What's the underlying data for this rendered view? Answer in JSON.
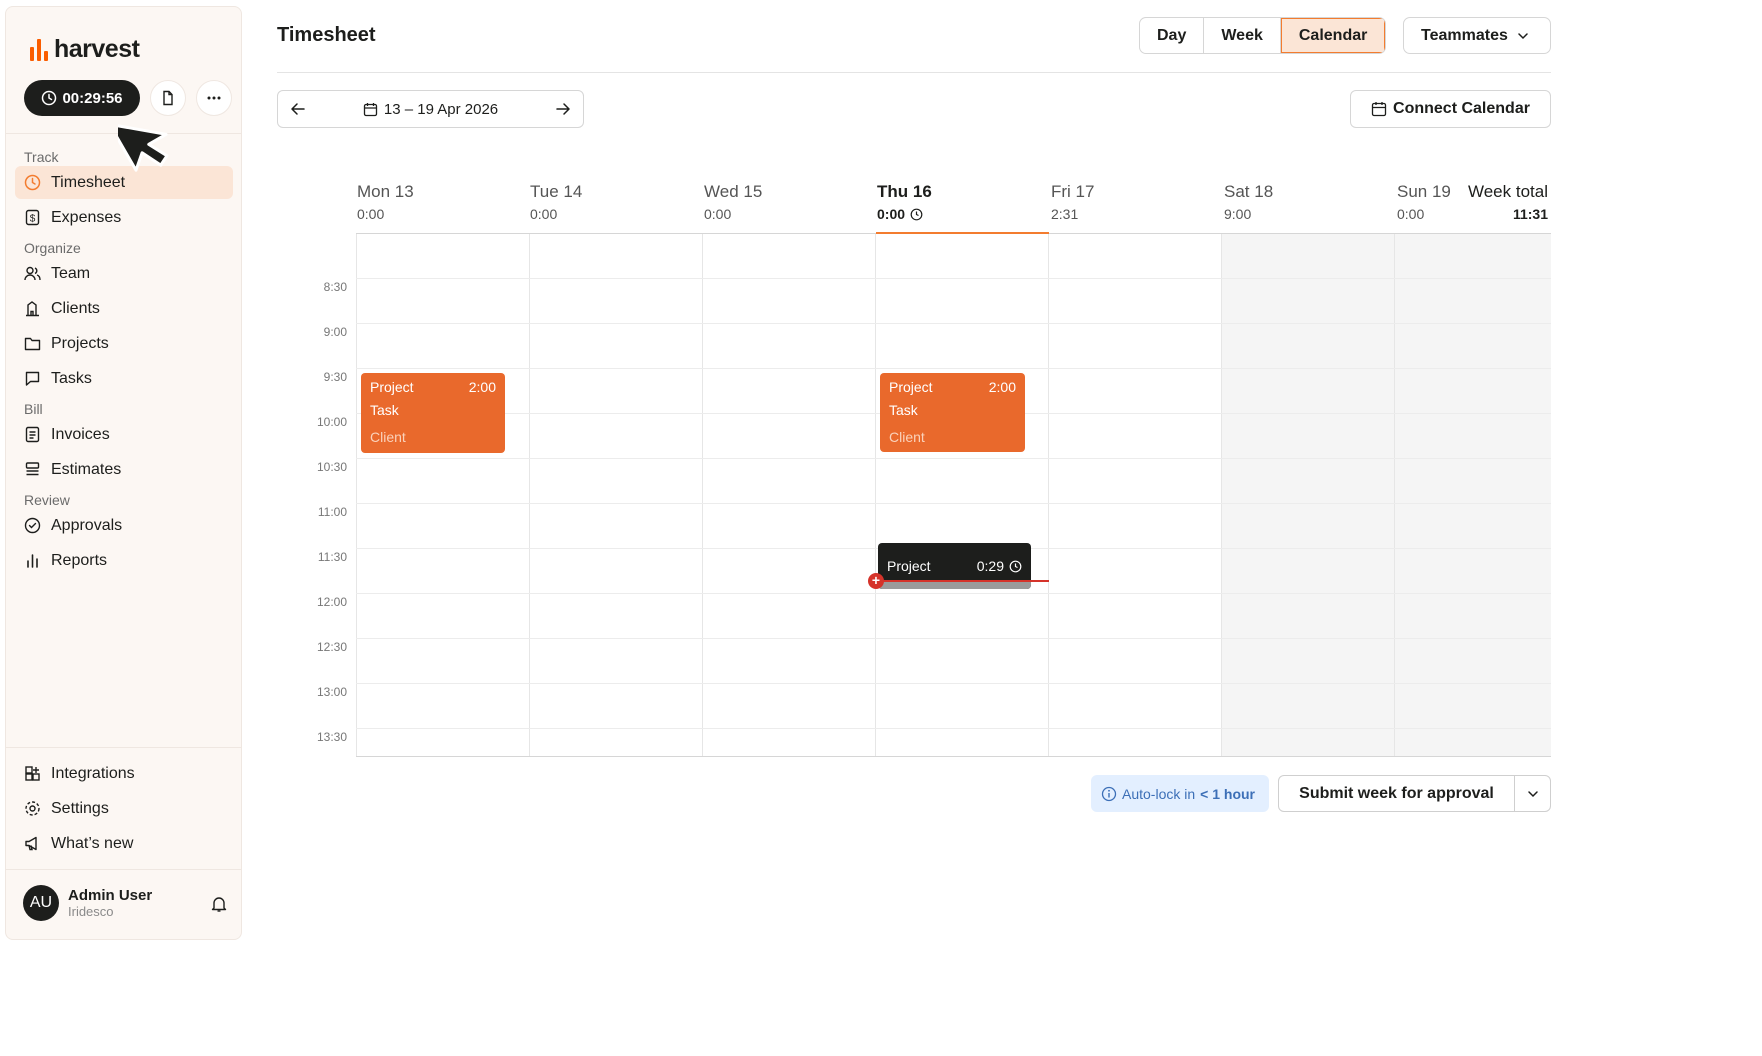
{
  "app": {
    "logo_text": "harvest"
  },
  "timer": {
    "value": "00:29:56"
  },
  "sidebar": {
    "sections": [
      "Track",
      "Organize",
      "Bill",
      "Review"
    ],
    "items": [
      {
        "label": "Timesheet",
        "icon": "clock-icon",
        "active": true
      },
      {
        "label": "Expenses",
        "icon": "receipt-icon"
      },
      {
        "label": "Team",
        "icon": "people-icon"
      },
      {
        "label": "Clients",
        "icon": "building-icon"
      },
      {
        "label": "Projects",
        "icon": "folder-icon"
      },
      {
        "label": "Tasks",
        "icon": "checkbox-icon"
      },
      {
        "label": "Invoices",
        "icon": "invoice-icon"
      },
      {
        "label": "Estimates",
        "icon": "estimate-icon"
      },
      {
        "label": "Approvals",
        "icon": "check-circle-icon"
      },
      {
        "label": "Reports",
        "icon": "bar-chart-icon"
      }
    ],
    "footer_items": [
      {
        "label": "Integrations",
        "icon": "integrations-icon"
      },
      {
        "label": "Settings",
        "icon": "gear-icon"
      },
      {
        "label": "What’s new",
        "icon": "megaphone-icon"
      }
    ]
  },
  "user": {
    "initials": "AU",
    "name": "Admin User",
    "org": "Iridesco"
  },
  "header": {
    "title": "Timesheet",
    "view_tabs": [
      "Day",
      "Week",
      "Calendar"
    ],
    "active_view": "Calendar",
    "teammates_label": "Teammates"
  },
  "date_range": {
    "label": "13 – 19 Apr 2026"
  },
  "connect_calendar_label": "Connect Calendar",
  "days": [
    {
      "name": "Mon 13",
      "total": "0:00"
    },
    {
      "name": "Tue 14",
      "total": "0:00"
    },
    {
      "name": "Wed 15",
      "total": "0:00"
    },
    {
      "name": "Thu 16",
      "total": "0:00",
      "today": true
    },
    {
      "name": "Fri 17",
      "total": "2:31"
    },
    {
      "name": "Sat 18",
      "total": "9:00"
    },
    {
      "name": "Sun 19",
      "total": "0:00"
    }
  ],
  "week_total": {
    "label": "Week total",
    "value": "11:31"
  },
  "time_labels": [
    "8:30",
    "9:00",
    "9:30",
    "10:00",
    "10:30",
    "11:00",
    "11:30",
    "12:00",
    "12:30",
    "13:00",
    "13:30"
  ],
  "entries": [
    {
      "day": "Mon 13",
      "project": "Project",
      "duration": "2:00",
      "task": "Task",
      "client": "Client"
    },
    {
      "day": "Thu 16",
      "project": "Project",
      "duration": "2:00",
      "task": "Task",
      "client": "Client"
    }
  ],
  "running_entry": {
    "project": "Project",
    "duration": "0:29"
  },
  "footer": {
    "autolock_prefix": "Auto-lock in",
    "autolock_value": "< 1 hour",
    "submit_label": "Submit week for approval"
  },
  "colors": {
    "brand": "#fa5d00",
    "entry": "#e9692c",
    "running": "#1d1e1c",
    "now_line": "#d5332a"
  }
}
